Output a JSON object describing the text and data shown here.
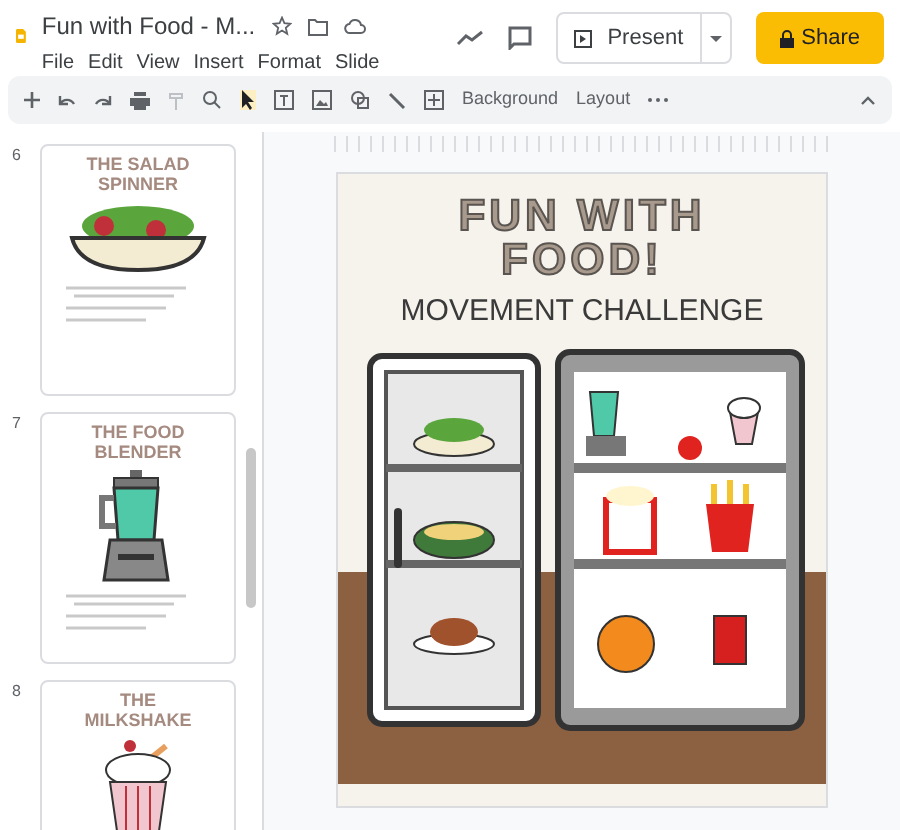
{
  "app": {
    "title": "Fun with Food - M...",
    "menu": [
      "File",
      "Edit",
      "View",
      "Insert",
      "Format",
      "Slide"
    ]
  },
  "header": {
    "present": "Present",
    "share": "Share"
  },
  "toolbar": {
    "background": "Background",
    "layout": "Layout"
  },
  "slides": [
    {
      "number": "6",
      "title": "THE SALAD SPINNER",
      "kind": "salad"
    },
    {
      "number": "7",
      "title": "THE FOOD BLENDER",
      "kind": "blender"
    },
    {
      "number": "8",
      "title": "THE MILKSHAKE",
      "kind": "milkshake"
    }
  ],
  "slide": {
    "title": "FUN WITH FOOD!",
    "subtitle": "MOVEMENT CHALLENGE"
  }
}
